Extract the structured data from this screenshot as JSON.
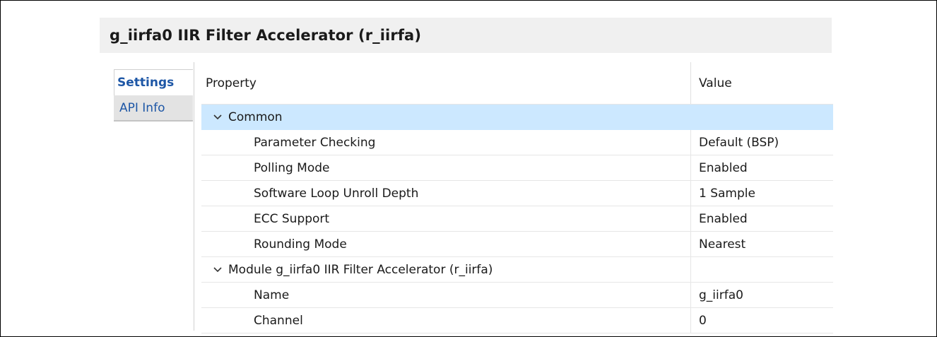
{
  "title": "g_iirfa0 IIR Filter Accelerator (r_iirfa)",
  "tabs": [
    {
      "label": "Settings",
      "active": true
    },
    {
      "label": "API Info",
      "active": false
    }
  ],
  "table": {
    "headers": {
      "property": "Property",
      "value": "Value"
    },
    "groups": [
      {
        "label": "Common",
        "expanded": true,
        "selected": true,
        "rows": [
          {
            "property": "Parameter Checking",
            "value": "Default (BSP)"
          },
          {
            "property": "Polling Mode",
            "value": "Enabled"
          },
          {
            "property": "Software Loop Unroll Depth",
            "value": "1 Sample"
          },
          {
            "property": "ECC Support",
            "value": "Enabled"
          },
          {
            "property": "Rounding Mode",
            "value": "Nearest"
          }
        ]
      },
      {
        "label": "Module g_iirfa0 IIR Filter Accelerator (r_iirfa)",
        "expanded": true,
        "selected": false,
        "rows": [
          {
            "property": "Name",
            "value": "g_iirfa0"
          },
          {
            "property": "Channel",
            "value": "0"
          }
        ]
      }
    ]
  },
  "colors": {
    "selected_row": "#cce8ff",
    "tab_text": "#1e57a6",
    "title_bar": "#f0f0f0"
  },
  "icons": {
    "expand": "chevron-down-icon"
  }
}
